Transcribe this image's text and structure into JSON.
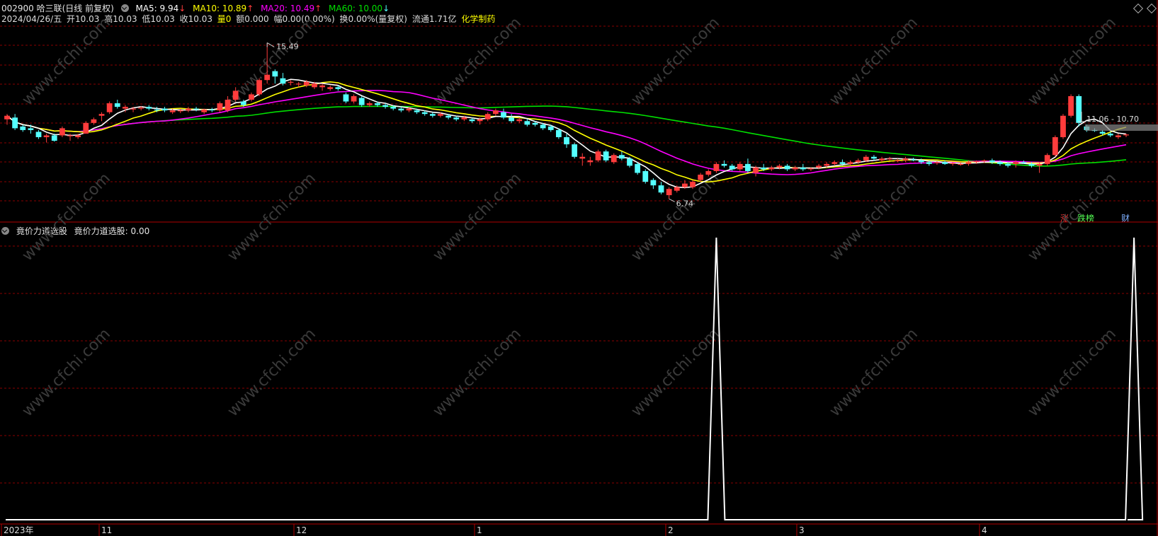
{
  "header": {
    "stock": "002900 哈三联(日线 前复权)",
    "ma5": "MA5: 9.94",
    "ma10": "MA10: 10.89",
    "ma20": "MA20: 10.49",
    "ma60": "MA60: 10.00",
    "date": "2024/04/26/五",
    "open": "开10.03",
    "high": "高10.03",
    "low": "低10.03",
    "close": "收10.03",
    "vol": "量0",
    "amount": "额0.000",
    "change": "幅0.00(0.00%)",
    "turnover": "换0.00%(量复权)",
    "float": "流通1.71亿",
    "industry": "化学制药"
  },
  "annotations": {
    "high_price": "15.49",
    "low_price": "6.74",
    "range": "11.06 - 10.70"
  },
  "badges": {
    "rise": "涨",
    "list": "跌榜",
    "finance": "财"
  },
  "indicator": {
    "name": "竟价力道选股",
    "value_text": "竟价力道选股: 0.00"
  },
  "time_axis": [
    "2023年",
    "11",
    "12",
    "1",
    "2",
    "3",
    "4"
  ],
  "watermark": "www.cfchi.com",
  "colors": {
    "up": "#ff3c3c",
    "down": "#54ffff",
    "ma5": "#ffffff",
    "ma10": "#ffff00",
    "ma20": "#ff00ff",
    "ma60": "#00e000",
    "grid": "#8a0000",
    "frame": "#b00000"
  },
  "chart_data": {
    "type": "candlestick",
    "y_range": [
      6.0,
      16.5
    ],
    "candles": [
      [
        11.2,
        11.5,
        10.9,
        11.4
      ],
      [
        11.3,
        11.5,
        10.6,
        10.7
      ],
      [
        10.8,
        10.9,
        10.5,
        10.6
      ],
      [
        10.7,
        10.9,
        10.4,
        10.6
      ],
      [
        10.5,
        10.6,
        10.1,
        10.2
      ],
      [
        10.2,
        10.4,
        9.9,
        10.3
      ],
      [
        10.3,
        10.4,
        9.95,
        10.0
      ],
      [
        10.3,
        10.8,
        10.2,
        10.7
      ],
      [
        10.3,
        10.4,
        10.0,
        10.3
      ],
      [
        10.2,
        10.4,
        10.1,
        10.3
      ],
      [
        10.4,
        11.1,
        10.4,
        11.0
      ],
      [
        11.0,
        11.3,
        10.9,
        11.2
      ],
      [
        11.4,
        11.6,
        11.1,
        11.5
      ],
      [
        11.6,
        12.2,
        11.5,
        12.1
      ],
      [
        12.1,
        12.3,
        11.8,
        11.9
      ],
      [
        11.8,
        12.0,
        11.6,
        11.9
      ],
      [
        11.8,
        11.9,
        11.6,
        11.8
      ],
      [
        11.8,
        11.95,
        11.7,
        11.85
      ],
      [
        11.9,
        12.0,
        11.7,
        11.8
      ],
      [
        11.75,
        11.9,
        11.6,
        11.7
      ],
      [
        11.8,
        11.9,
        11.6,
        11.7
      ],
      [
        11.6,
        11.8,
        11.5,
        11.7
      ],
      [
        11.65,
        11.8,
        11.55,
        11.7
      ],
      [
        11.7,
        11.9,
        11.6,
        11.8
      ],
      [
        11.8,
        11.9,
        11.65,
        11.75
      ],
      [
        11.6,
        11.8,
        11.5,
        11.75
      ],
      [
        11.75,
        11.85,
        11.6,
        11.7
      ],
      [
        11.7,
        12.2,
        11.6,
        12.1
      ],
      [
        11.7,
        12.5,
        11.6,
        12.3
      ],
      [
        12.3,
        13.0,
        12.2,
        12.8
      ],
      [
        12.2,
        12.3,
        11.9,
        12.0
      ],
      [
        12.3,
        12.7,
        12.2,
        12.6
      ],
      [
        12.6,
        13.5,
        12.5,
        13.4
      ],
      [
        13.4,
        15.49,
        13.2,
        13.7
      ],
      [
        13.9,
        14.0,
        13.2,
        13.6
      ],
      [
        13.5,
        13.8,
        13.1,
        13.2
      ],
      [
        13.3,
        13.4,
        13.1,
        13.3
      ],
      [
        13.2,
        13.3,
        13.0,
        13.2
      ],
      [
        13.1,
        13.4,
        13.0,
        13.3
      ],
      [
        13.0,
        13.3,
        12.9,
        13.2
      ],
      [
        13.0,
        13.2,
        12.8,
        13.1
      ],
      [
        12.9,
        13.1,
        12.8,
        13.0
      ],
      [
        13.0,
        13.1,
        12.8,
        12.9
      ],
      [
        12.6,
        12.7,
        12.1,
        12.2
      ],
      [
        12.2,
        12.6,
        12.1,
        12.5
      ],
      [
        12.4,
        12.5,
        11.9,
        12.0
      ],
      [
        12.0,
        12.2,
        11.9,
        12.1
      ],
      [
        12.1,
        12.2,
        11.9,
        12.0
      ],
      [
        12.0,
        12.1,
        11.8,
        11.9
      ],
      [
        11.9,
        12.0,
        11.7,
        11.8
      ],
      [
        11.8,
        11.9,
        11.6,
        11.7
      ],
      [
        11.7,
        11.9,
        11.6,
        11.8
      ],
      [
        11.7,
        11.8,
        11.5,
        11.6
      ],
      [
        11.6,
        11.7,
        11.4,
        11.5
      ],
      [
        11.5,
        11.6,
        11.3,
        11.4
      ],
      [
        11.4,
        11.6,
        11.3,
        11.5
      ],
      [
        11.4,
        11.5,
        11.2,
        11.3
      ],
      [
        11.3,
        11.4,
        11.1,
        11.2
      ],
      [
        11.2,
        11.4,
        11.1,
        11.3
      ],
      [
        11.2,
        11.3,
        11.0,
        11.1
      ],
      [
        11.1,
        11.3,
        10.9,
        11.2
      ],
      [
        11.2,
        11.6,
        11.1,
        11.5
      ],
      [
        11.5,
        11.8,
        11.4,
        11.7
      ],
      [
        11.6,
        11.8,
        11.2,
        11.3
      ],
      [
        11.3,
        11.5,
        11.0,
        11.1
      ],
      [
        11.1,
        11.3,
        11.0,
        11.2
      ],
      [
        11.1,
        11.2,
        10.8,
        10.9
      ],
      [
        11.0,
        11.1,
        10.8,
        10.9
      ],
      [
        10.9,
        11.0,
        10.6,
        10.7
      ],
      [
        10.8,
        10.9,
        10.5,
        10.6
      ],
      [
        10.6,
        10.7,
        10.1,
        10.2
      ],
      [
        10.2,
        10.4,
        9.6,
        9.8
      ],
      [
        9.8,
        9.9,
        9.0,
        9.1
      ],
      [
        9.0,
        9.3,
        8.6,
        9.1
      ],
      [
        8.8,
        9.1,
        8.6,
        8.9
      ],
      [
        8.9,
        9.5,
        8.8,
        9.4
      ],
      [
        9.4,
        9.5,
        8.8,
        8.9
      ],
      [
        8.8,
        9.3,
        8.7,
        9.2
      ],
      [
        9.2,
        9.4,
        8.9,
        9.0
      ],
      [
        9.0,
        9.1,
        8.5,
        8.6
      ],
      [
        8.7,
        8.8,
        8.1,
        8.2
      ],
      [
        8.3,
        8.4,
        7.6,
        7.7
      ],
      [
        7.8,
        7.9,
        7.3,
        7.5
      ],
      [
        7.5,
        7.7,
        7.0,
        7.1
      ],
      [
        6.95,
        7.4,
        6.74,
        7.3
      ],
      [
        7.2,
        7.5,
        7.1,
        7.4
      ],
      [
        7.4,
        7.8,
        7.3,
        7.6
      ],
      [
        7.4,
        7.8,
        7.3,
        7.7
      ],
      [
        7.8,
        8.2,
        7.7,
        8.1
      ],
      [
        8.1,
        8.4,
        8.0,
        8.3
      ],
      [
        8.3,
        8.8,
        8.2,
        8.7
      ],
      [
        8.7,
        8.9,
        8.5,
        8.6
      ],
      [
        8.6,
        8.7,
        8.3,
        8.4
      ],
      [
        8.4,
        8.8,
        8.3,
        8.7
      ],
      [
        8.7,
        9.0,
        8.2,
        8.3
      ],
      [
        8.2,
        8.6,
        8.0,
        8.5
      ],
      [
        8.5,
        8.7,
        8.3,
        8.4
      ],
      [
        8.4,
        8.6,
        8.3,
        8.5
      ],
      [
        8.5,
        8.7,
        8.4,
        8.6
      ],
      [
        8.6,
        8.7,
        8.3,
        8.4
      ],
      [
        8.4,
        8.6,
        8.3,
        8.5
      ],
      [
        8.5,
        8.7,
        8.3,
        8.4
      ],
      [
        8.4,
        8.5,
        8.3,
        8.45
      ],
      [
        8.5,
        8.7,
        8.4,
        8.6
      ],
      [
        8.6,
        8.8,
        8.5,
        8.7
      ],
      [
        8.7,
        8.9,
        8.6,
        8.8
      ],
      [
        8.8,
        8.95,
        8.6,
        8.7
      ],
      [
        8.7,
        8.9,
        8.6,
        8.8
      ],
      [
        8.8,
        9.0,
        8.7,
        8.9
      ],
      [
        8.9,
        9.2,
        8.8,
        9.1
      ],
      [
        9.1,
        9.2,
        8.9,
        9.0
      ],
      [
        8.9,
        9.1,
        8.8,
        9.0
      ],
      [
        9.0,
        9.1,
        8.9,
        9.0
      ],
      [
        8.9,
        9.0,
        8.8,
        8.9
      ],
      [
        8.9,
        9.1,
        8.8,
        9.0
      ],
      [
        8.95,
        9.05,
        8.85,
        8.9
      ],
      [
        8.9,
        9.0,
        8.7,
        8.8
      ],
      [
        8.8,
        8.9,
        8.6,
        8.7
      ],
      [
        8.75,
        8.85,
        8.65,
        8.8
      ],
      [
        8.8,
        8.9,
        8.65,
        8.7
      ],
      [
        8.7,
        8.8,
        8.6,
        8.75
      ],
      [
        8.7,
        8.8,
        8.6,
        8.7
      ],
      [
        8.7,
        8.9,
        8.6,
        8.8
      ],
      [
        8.8,
        8.9,
        8.7,
        8.85
      ],
      [
        8.85,
        8.95,
        8.75,
        8.9
      ],
      [
        8.9,
        9.0,
        8.7,
        8.8
      ],
      [
        8.8,
        8.9,
        8.6,
        8.7
      ],
      [
        8.7,
        8.8,
        8.5,
        8.6
      ],
      [
        8.7,
        8.9,
        8.5,
        8.8
      ],
      [
        8.8,
        8.9,
        8.7,
        8.75
      ],
      [
        8.7,
        8.8,
        8.5,
        8.6
      ],
      [
        8.6,
        8.8,
        8.2,
        8.7
      ],
      [
        8.7,
        9.3,
        8.6,
        9.2
      ],
      [
        9.2,
        10.3,
        9.1,
        10.2
      ],
      [
        10.2,
        11.5,
        10.1,
        11.4
      ],
      [
        11.4,
        12.6,
        11.3,
        12.5
      ],
      [
        12.5,
        12.6,
        10.8,
        11.0
      ],
      [
        10.8,
        10.9,
        10.5,
        10.6
      ],
      [
        10.6,
        10.7,
        10.5,
        10.55
      ],
      [
        10.5,
        10.6,
        10.3,
        10.4
      ],
      [
        10.4,
        10.5,
        10.2,
        10.3
      ],
      [
        10.2,
        10.4,
        10.1,
        10.3
      ],
      [
        10.3,
        10.4,
        10.2,
        10.35
      ]
    ],
    "indicator_series": {
      "name": "竟价力道选股",
      "value": 0.0,
      "spikes_at_index": [
        90,
        143
      ]
    }
  }
}
